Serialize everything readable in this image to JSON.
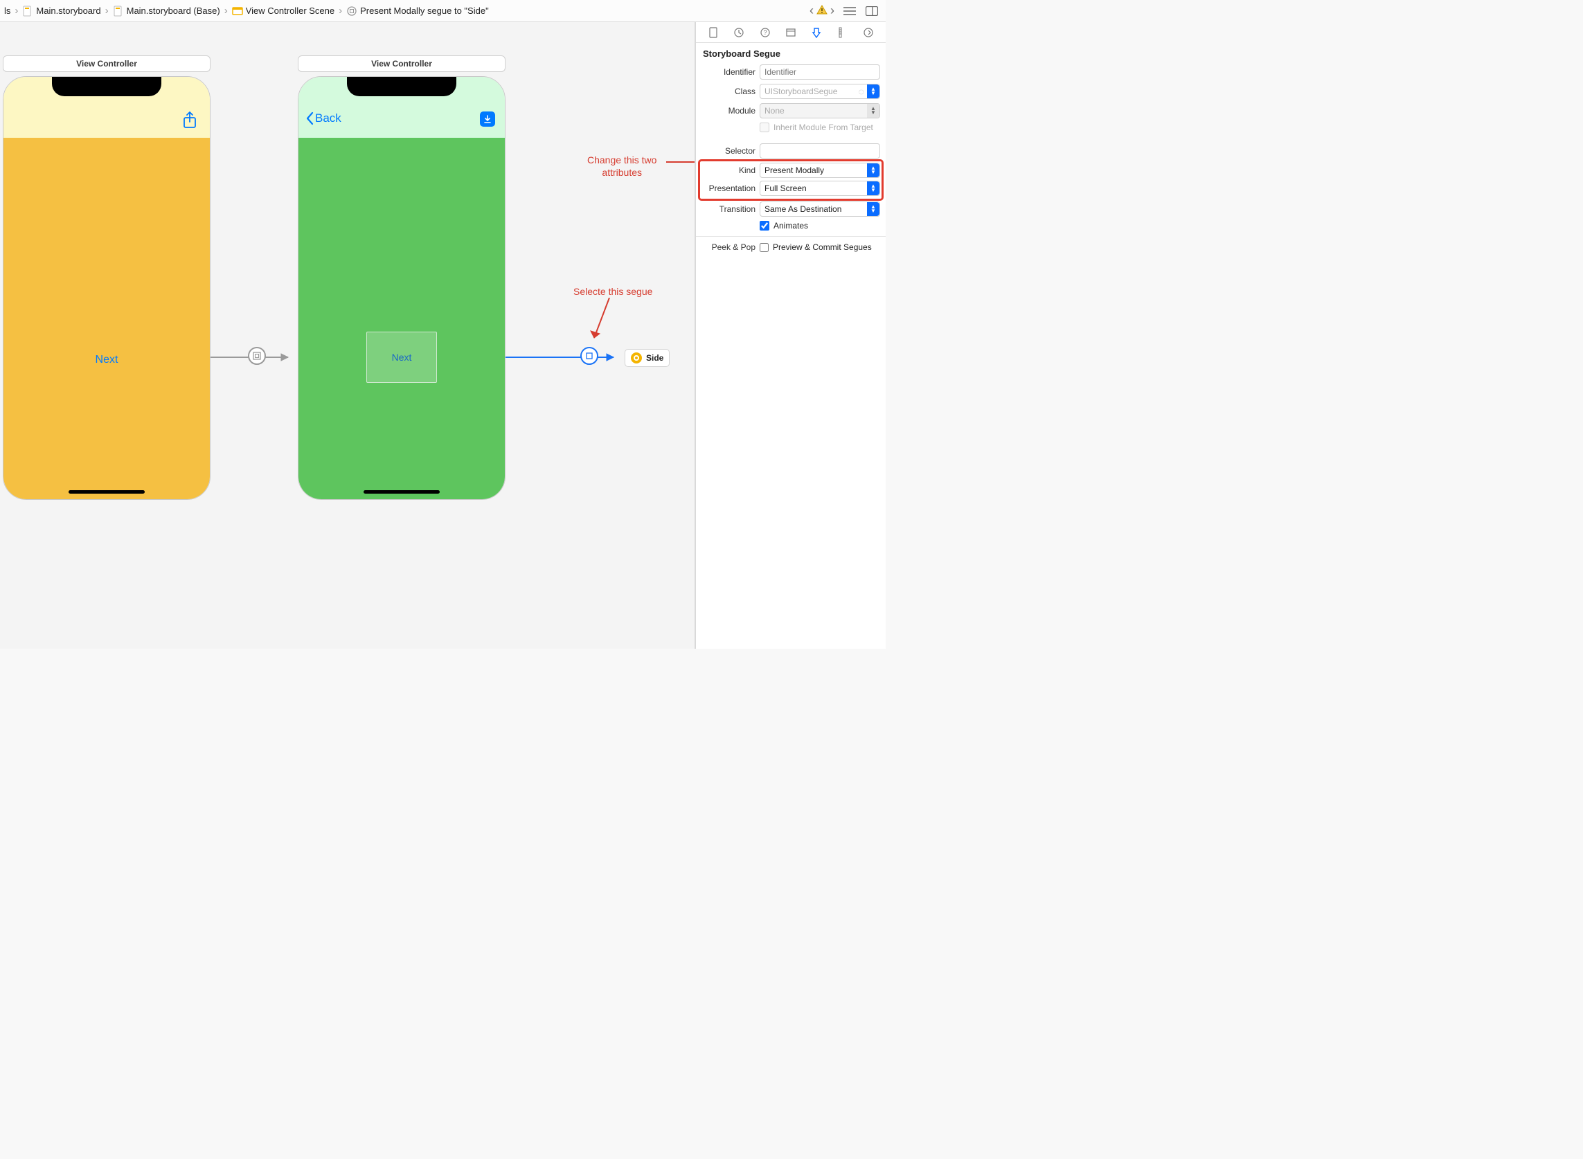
{
  "breadcrumb": {
    "item0": "ls",
    "item1": "Main.storyboard",
    "item2": "Main.storyboard (Base)",
    "item3": "View Controller Scene",
    "item4": "Present Modally segue to \"Side\""
  },
  "canvas": {
    "scene1_title": "View Controller",
    "scene2_title": "View Controller",
    "phone1_button": "Next",
    "phone2_back": "Back",
    "phone2_button": "Next",
    "side_chip": "Side"
  },
  "annotations": {
    "change_attrs": "Change this two\nattributes",
    "select_segue": "Selecte this segue"
  },
  "inspector": {
    "section": "Storyboard Segue",
    "identifier_label": "Identifier",
    "identifier_placeholder": "Identifier",
    "class_label": "Class",
    "class_value": "UIStoryboardSegue",
    "module_label": "Module",
    "module_value": "None",
    "inherit_label": "Inherit Module From Target",
    "selector_label": "Selector",
    "selector_value": "",
    "kind_label": "Kind",
    "kind_value": "Present Modally",
    "presentation_label": "Presentation",
    "presentation_value": "Full Screen",
    "transition_label": "Transition",
    "transition_value": "Same As Destination",
    "animates_label": "Animates",
    "peekpop_label": "Peek & Pop",
    "peekpop_check": "Preview & Commit Segues"
  }
}
